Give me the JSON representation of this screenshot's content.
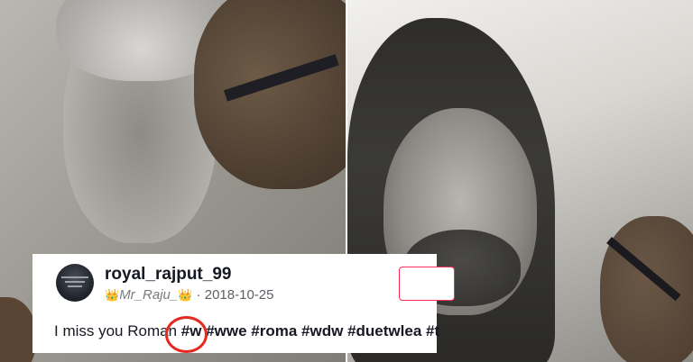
{
  "comment": {
    "username": "royal_rajput_99",
    "crown_left": "👑",
    "handle": "Mr_Raju_",
    "crown_right": "👑",
    "separator": "·",
    "date": "2018-10-25",
    "caption_text": "I miss you Roman ",
    "hashtags": [
      "#w",
      "#wwe",
      "#roma",
      "#wdw",
      "#duetwlea",
      "#t"
    ]
  },
  "colors": {
    "follow_border": "#fe2c55",
    "annotation_circle": "#e8281e",
    "crown": "#e3b320"
  },
  "icons": {
    "avatar": "profile-avatar",
    "crowns": "crown-emoji"
  }
}
